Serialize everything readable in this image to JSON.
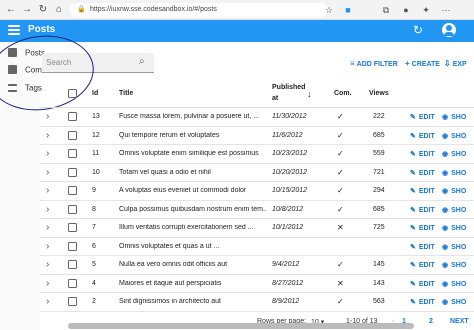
{
  "browser": {
    "url": "https://iuxnw.sse.codesandbox.io/#/posts",
    "nav": [
      "←",
      "→",
      "↻",
      "⌂"
    ],
    "lock_icon": "lock-icon"
  },
  "appbar": {
    "title": "Posts",
    "color": "#2196f3"
  },
  "sidebar": {
    "items": [
      {
        "label": "Posts",
        "icon": "book-icon"
      },
      {
        "label": "Comments",
        "icon": "chat-icon"
      },
      {
        "label": "Tags",
        "icon": "list-icon"
      }
    ]
  },
  "search": {
    "placeholder": "Search"
  },
  "toolbar": {
    "add_filter": "ADD FILTER",
    "create": "CREATE",
    "export": "EXP"
  },
  "table": {
    "headers": {
      "id": "Id",
      "title": "Title",
      "published_at_1": "Published",
      "published_at_2": "at",
      "com": "Com.",
      "views": "Views"
    },
    "actions": {
      "edit": "EDIT",
      "show": "SHO"
    },
    "rows": [
      {
        "id": "13",
        "title": "Fusce massa lorem, pulvinar a posuere ut, ...",
        "date": "11/30/2012",
        "com": "✓",
        "views": "222"
      },
      {
        "id": "12",
        "title": "Qui tempore rerum et voluptates",
        "date": "11/6/2012",
        "com": "✓",
        "views": "685"
      },
      {
        "id": "11",
        "title": "Omnis voluptate enim similique est possimus",
        "date": "10/23/2012",
        "com": "✓",
        "views": "559"
      },
      {
        "id": "10",
        "title": "Totam vel quasi a odio et nihil",
        "date": "10/20/2012",
        "com": "✓",
        "views": "721"
      },
      {
        "id": "9",
        "title": "A voluptas eius eveniet ut commodi dolor",
        "date": "10/15/2012",
        "com": "✓",
        "views": "294"
      },
      {
        "id": "8",
        "title": "Culpa possimus quibusdam nostrum enim tem...",
        "date": "10/8/2012",
        "com": "✓",
        "views": "685"
      },
      {
        "id": "7",
        "title": "Illum veritatis corrupti exercitationem sed ...",
        "date": "10/1/2012",
        "com": "✕",
        "views": "725"
      },
      {
        "id": "6",
        "title": "Omnis voluptates et quas a ut ...",
        "date": "",
        "com": "",
        "views": ""
      },
      {
        "id": "5",
        "title": "Nulla ea vero omnis odit officiis aut",
        "date": "9/4/2012",
        "com": "✓",
        "views": "145"
      },
      {
        "id": "4",
        "title": "Maiores et itaque aut perspiciatis",
        "date": "8/27/2012",
        "com": "✕",
        "views": "143"
      },
      {
        "id": "2",
        "title": "Sint dignissimos in architecto aut",
        "date": "8/9/2012",
        "com": "✓",
        "views": "563"
      }
    ]
  },
  "footer": {
    "rows_per_page_label": "Rows per page:",
    "rows_per_page_value": "10",
    "range": "1-10 of 13",
    "page_current": "1",
    "page_next_num": "2",
    "next": "NEXT"
  }
}
